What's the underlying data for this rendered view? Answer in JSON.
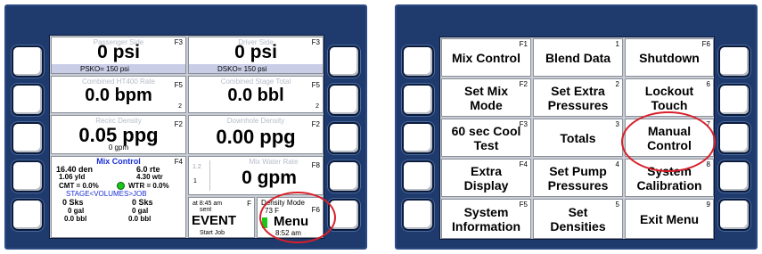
{
  "left": {
    "passenger": {
      "caption": "Passenger Side",
      "fkey": "F3",
      "value": "0 psi",
      "sub": "PSKO=     150 psi"
    },
    "driver": {
      "caption": "Driver Side",
      "fkey": "F3",
      "value": "0 psi",
      "sub": "DSKO=     150 psi"
    },
    "rate": {
      "caption": "Combined HT400 Rate",
      "fkey": "F5",
      "value": "0.0 bpm",
      "badge": "2"
    },
    "stage": {
      "caption": "Combined Stage Total",
      "fkey": "F5",
      "value": "0.0 bbl",
      "badge": "2"
    },
    "recirc": {
      "caption": "Recirc Density",
      "fkey": "F2",
      "value": "0.05 ppg",
      "sub": "0 gpm"
    },
    "downhole": {
      "caption": "Downhole Density",
      "fkey": "F2",
      "value": "0.00 ppg"
    },
    "mix": {
      "title": "Mix Control",
      "fkey": "F4",
      "line1a": "16.40 den",
      "line1b": "6.0 rte",
      "line2a": "1.06 yld",
      "line2b": "4.30 wtr",
      "line3a": "CMT = 0.0%",
      "line3b": "WTR = 0.0%",
      "stage_line": "STAGE<VOLUMES>JOB",
      "sks_a": "0 Sks",
      "sks_b": "0 Sks",
      "gal_a": "0 gal",
      "gal_b": "0 gal",
      "bbl_a": "0.0 bbl",
      "bbl_b": "0.0 bbl"
    },
    "mixwater": {
      "caption": "Mix Water Rate",
      "fkey": "F8",
      "value": "0 gpm",
      "idx_a": "1.2",
      "idx_b": "1"
    },
    "event": {
      "line1": "at 8:45 am",
      "line2": "sent",
      "fkey": "F",
      "label": "EVENT",
      "button": "Start Job"
    },
    "menu": {
      "mode": "Density Mode",
      "temp": "73 F",
      "fkey": "F6",
      "label": "Menu",
      "time": "8:52 am"
    }
  },
  "right": {
    "keys": [
      {
        "label": "Mix Control",
        "num": "F1"
      },
      {
        "label": "Blend Data",
        "num": "1"
      },
      {
        "label": "Shutdown",
        "num": "F6"
      },
      {
        "label": "Set Mix Mode",
        "num": "F2"
      },
      {
        "label": "Set Extra Pressures",
        "num": "2"
      },
      {
        "label": "Lockout Touch",
        "num": "6"
      },
      {
        "label": "60 sec Cool Test",
        "num": "F3"
      },
      {
        "label": "Totals",
        "num": "3"
      },
      {
        "label": "Manual Control",
        "num": "7"
      },
      {
        "label": "Extra Display",
        "num": "F4"
      },
      {
        "label": "Set Pump Pressures",
        "num": "4"
      },
      {
        "label": "System Calibration",
        "num": "8"
      },
      {
        "label": "System Information",
        "num": "F5"
      },
      {
        "label": "Set Densities",
        "num": "5"
      },
      {
        "label": "Exit Menu",
        "num": "9"
      }
    ]
  },
  "colors": {
    "bezel": "#1f3a6d",
    "highlight_circle": "#d8202a",
    "mix_title": "#1a2fd6",
    "indicator": "#19c719"
  }
}
